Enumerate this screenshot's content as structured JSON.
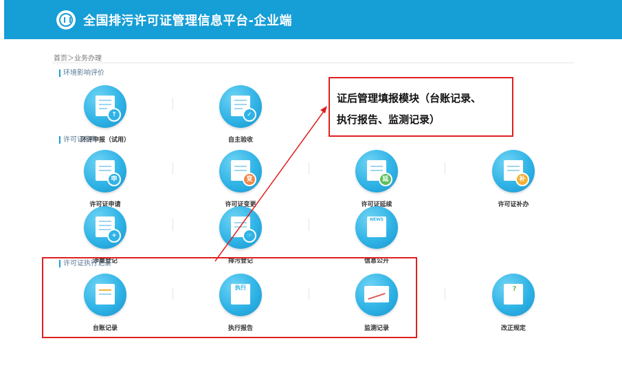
{
  "header": {
    "title": "全国排污许可证管理信息平台-企业端"
  },
  "breadcrumb": "首页＞业务办理",
  "sections": {
    "eia": "环境影响评价",
    "permit": "许可证业务",
    "execution": "许可证执行记录"
  },
  "items": {
    "eia_report": "环评申报（试用）",
    "self_acceptance": "自主验收",
    "permit_apply": "许可证申请",
    "permit_change": "许可证变更",
    "permit_renew": "许可证延续",
    "permit_reissue": "许可证补办",
    "key_register": "涉重登记",
    "discharge_register": "排污登记",
    "info_public": "信息公开",
    "ledger_record": "台账记录",
    "execution_report": "执行报告",
    "monitor_record": "监测记录",
    "rectify_rules": "改正规定"
  },
  "badges": {
    "apply": "申",
    "change": "变",
    "renew": "延",
    "reissue": "补",
    "exec": "执行",
    "news": "NEWS",
    "question": "?"
  },
  "callout": {
    "line1": "证后管理填报模块（台账记录、",
    "line2": "执行报告、监测记录）"
  },
  "colors": {
    "header": "#169ed6",
    "annotation": "#e01e1e"
  }
}
